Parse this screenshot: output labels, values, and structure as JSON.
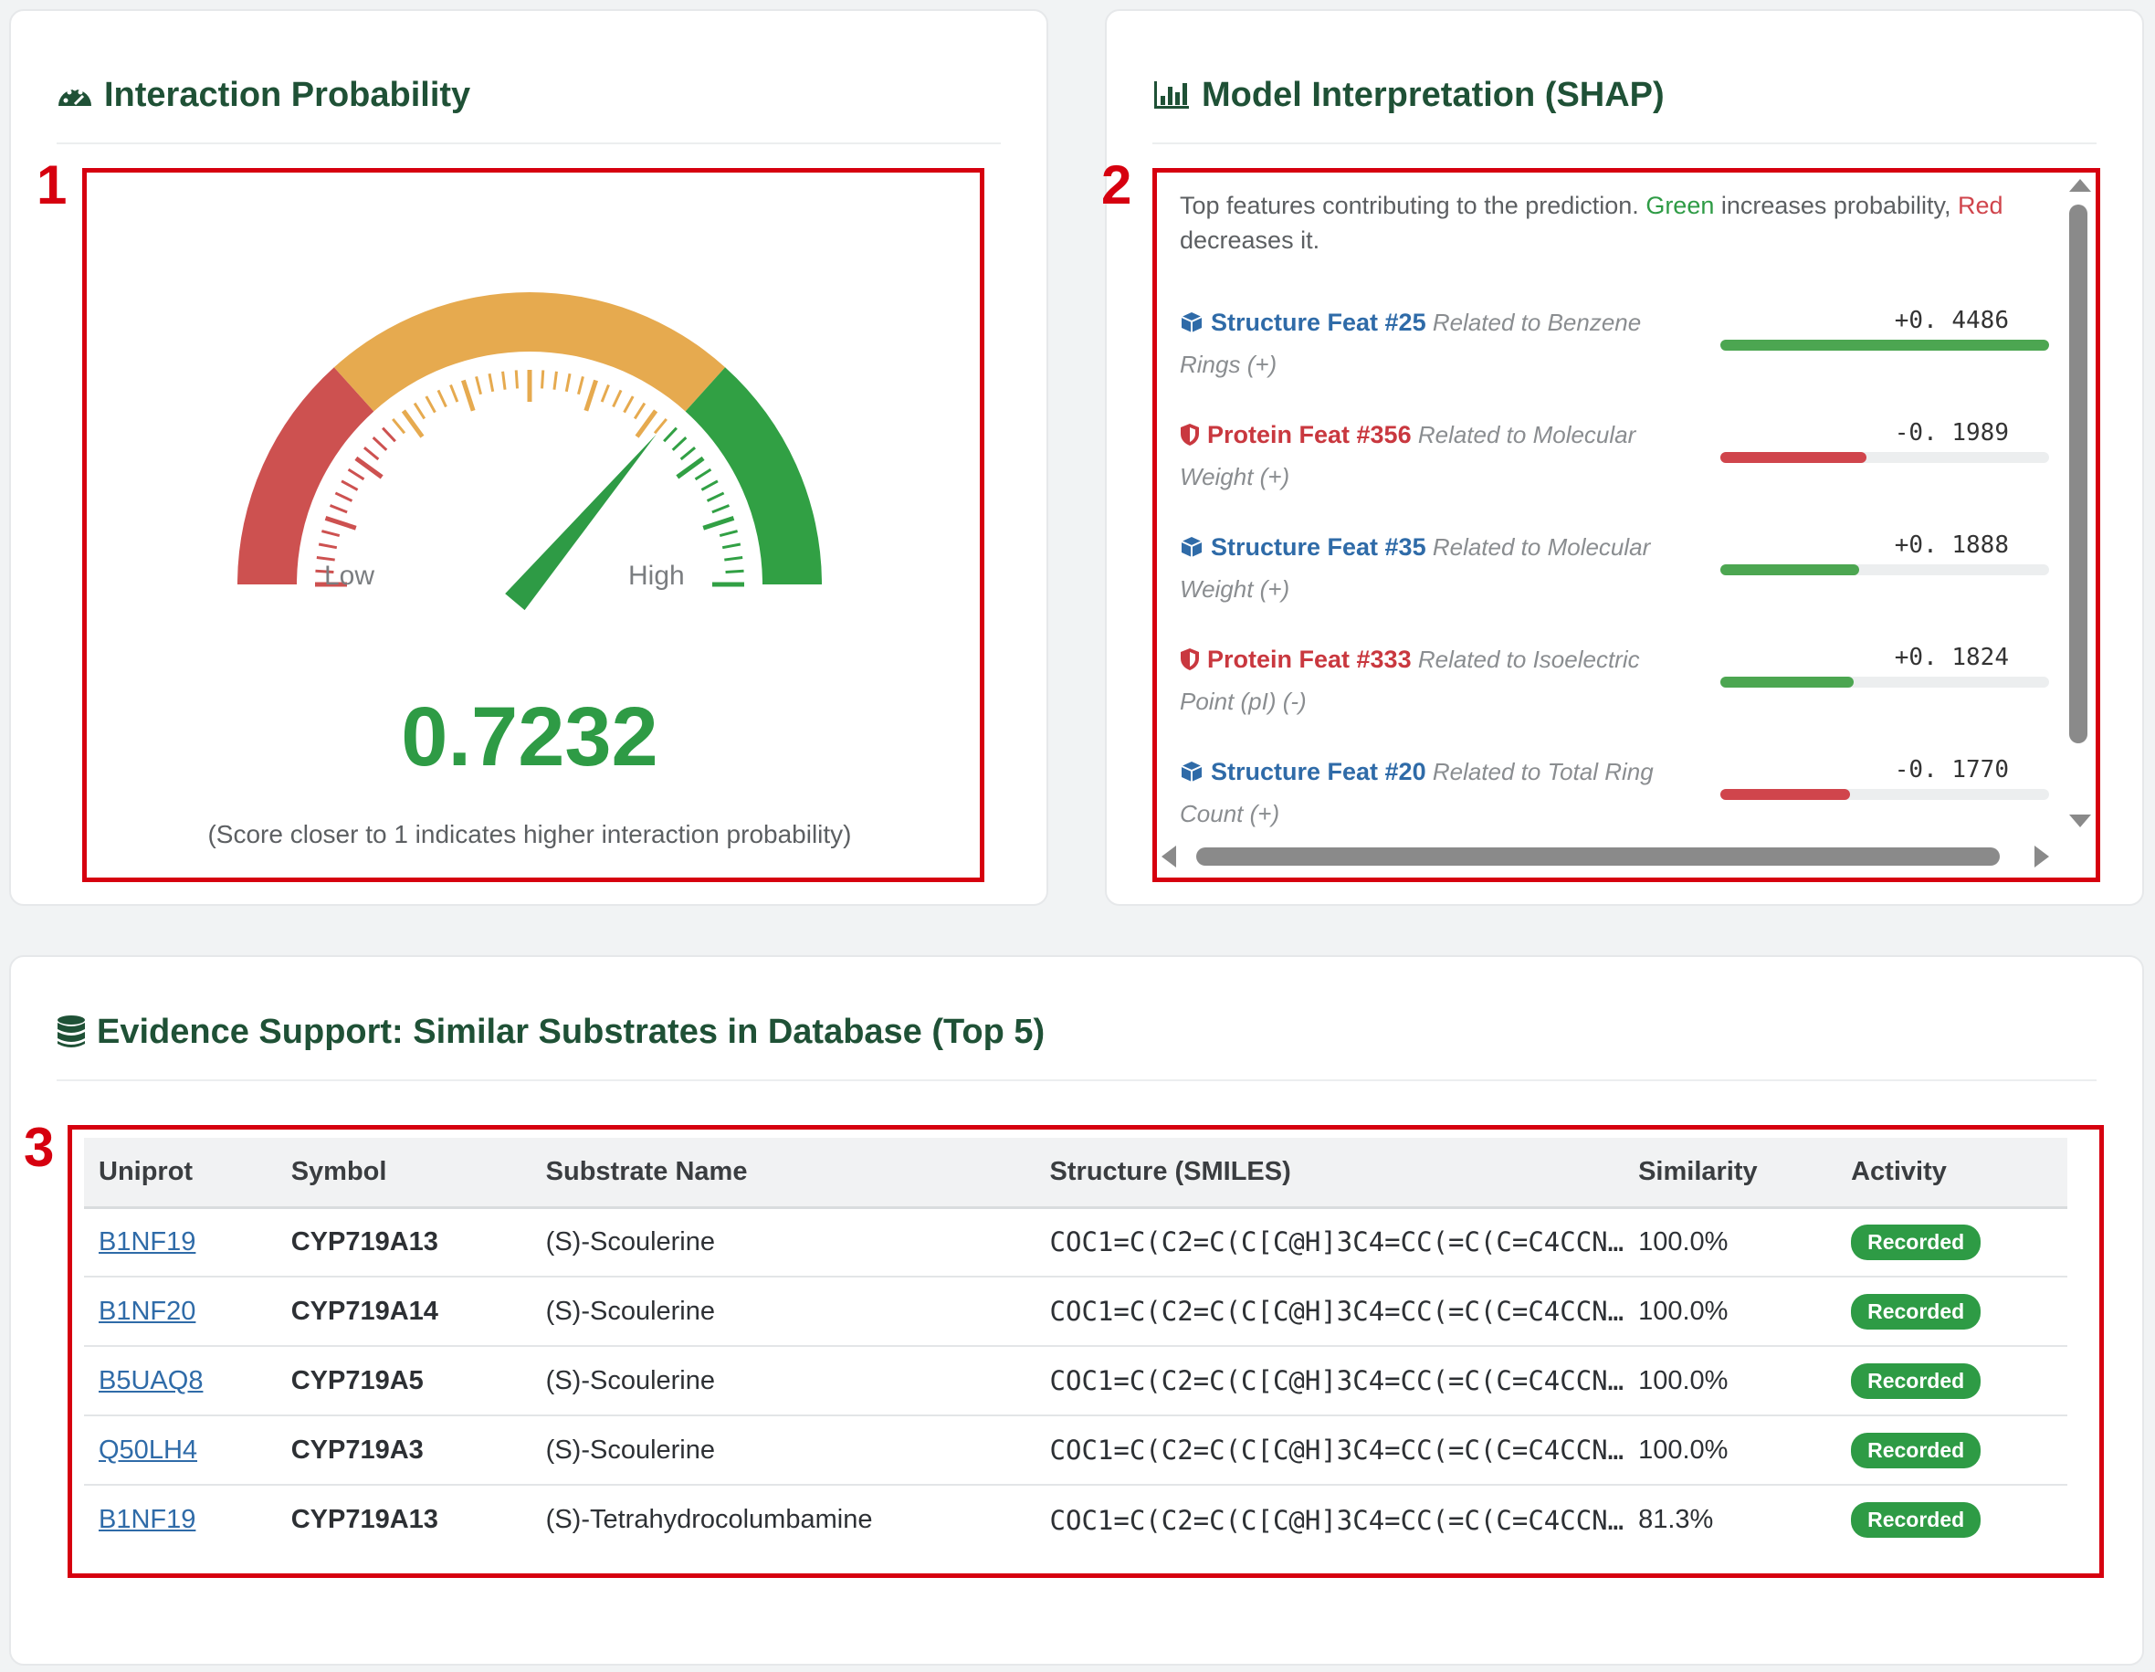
{
  "probability_card": {
    "title": "Interaction Probability",
    "gauge": {
      "low_label": "Low",
      "high_label": "High",
      "value": 0.7232
    },
    "score": "0.7232",
    "note": "(Score closer to 1 indicates higher interaction probability)"
  },
  "shap_card": {
    "title": "Model Interpretation (SHAP)",
    "desc_prefix": "Top features contributing to the prediction. ",
    "desc_green": "Green",
    "desc_mid": " increases probability, ",
    "desc_red": "Red",
    "desc_suffix": " decreases it.",
    "features": [
      {
        "kind": "structure",
        "name": "Structure Feat #25",
        "related": "Related to Benzene Rings (+)",
        "value": "+0. 4486",
        "magnitude": 0.4486,
        "direction": "positive"
      },
      {
        "kind": "protein",
        "name": "Protein Feat #356",
        "related": "Related to Molecular Weight (+)",
        "value": "-0. 1989",
        "magnitude": 0.1989,
        "direction": "negative"
      },
      {
        "kind": "structure",
        "name": "Structure Feat #35",
        "related": "Related to Molecular Weight (+)",
        "value": "+0. 1888",
        "magnitude": 0.1888,
        "direction": "positive"
      },
      {
        "kind": "protein",
        "name": "Protein Feat #333",
        "related": "Related to Isoelectric Point (pI) (-)",
        "value": "+0. 1824",
        "magnitude": 0.1824,
        "direction": "positive"
      },
      {
        "kind": "structure",
        "name": "Structure Feat #20",
        "related": "Related to Total Ring Count (+)",
        "value": "-0. 1770",
        "magnitude": 0.177,
        "direction": "negative"
      }
    ]
  },
  "evidence_card": {
    "title": "Evidence Support: Similar Substrates in Database (Top 5)",
    "columns": [
      "Uniprot",
      "Symbol",
      "Substrate Name",
      "Structure (SMILES)",
      "Similarity",
      "Activity"
    ],
    "rows": [
      {
        "uniprot": "B1NF19",
        "symbol": "CYP719A13",
        "substrate": "(S)-Scoulerine",
        "smiles": "COC1=C(C2=C(C[C@H]3C4=CC(=C(C=C4CCN…",
        "similarity": "100.0%",
        "activity": "Recorded"
      },
      {
        "uniprot": "B1NF20",
        "symbol": "CYP719A14",
        "substrate": "(S)-Scoulerine",
        "smiles": "COC1=C(C2=C(C[C@H]3C4=CC(=C(C=C4CCN…",
        "similarity": "100.0%",
        "activity": "Recorded"
      },
      {
        "uniprot": "B5UAQ8",
        "symbol": "CYP719A5",
        "substrate": "(S)-Scoulerine",
        "smiles": "COC1=C(C2=C(C[C@H]3C4=CC(=C(C=C4CCN…",
        "similarity": "100.0%",
        "activity": "Recorded"
      },
      {
        "uniprot": "Q50LH4",
        "symbol": "CYP719A3",
        "substrate": "(S)-Scoulerine",
        "smiles": "COC1=C(C2=C(C[C@H]3C4=CC(=C(C=C4CCN…",
        "similarity": "100.0%",
        "activity": "Recorded"
      },
      {
        "uniprot": "B1NF19",
        "symbol": "CYP719A13",
        "substrate": "(S)-Tetrahydrocolumbamine",
        "smiles": "COC1=C(C2=C(C[C@H]3C4=CC(=C(C=C4CCN…",
        "similarity": "81.3%",
        "activity": "Recorded"
      }
    ]
  },
  "annotations": [
    "1",
    "2",
    "3"
  ],
  "colors": {
    "green": "#2e9b45",
    "red": "#d0454c",
    "orange": "#e8a84c",
    "title": "#1f5136",
    "annotation": "#d6000f",
    "link": "#2f6ba8"
  },
  "icons": {
    "probability": "gauge-icon",
    "shap": "bar-chart-icon",
    "evidence": "database-icon",
    "structure": "cube-icon",
    "protein": "shield-icon"
  }
}
